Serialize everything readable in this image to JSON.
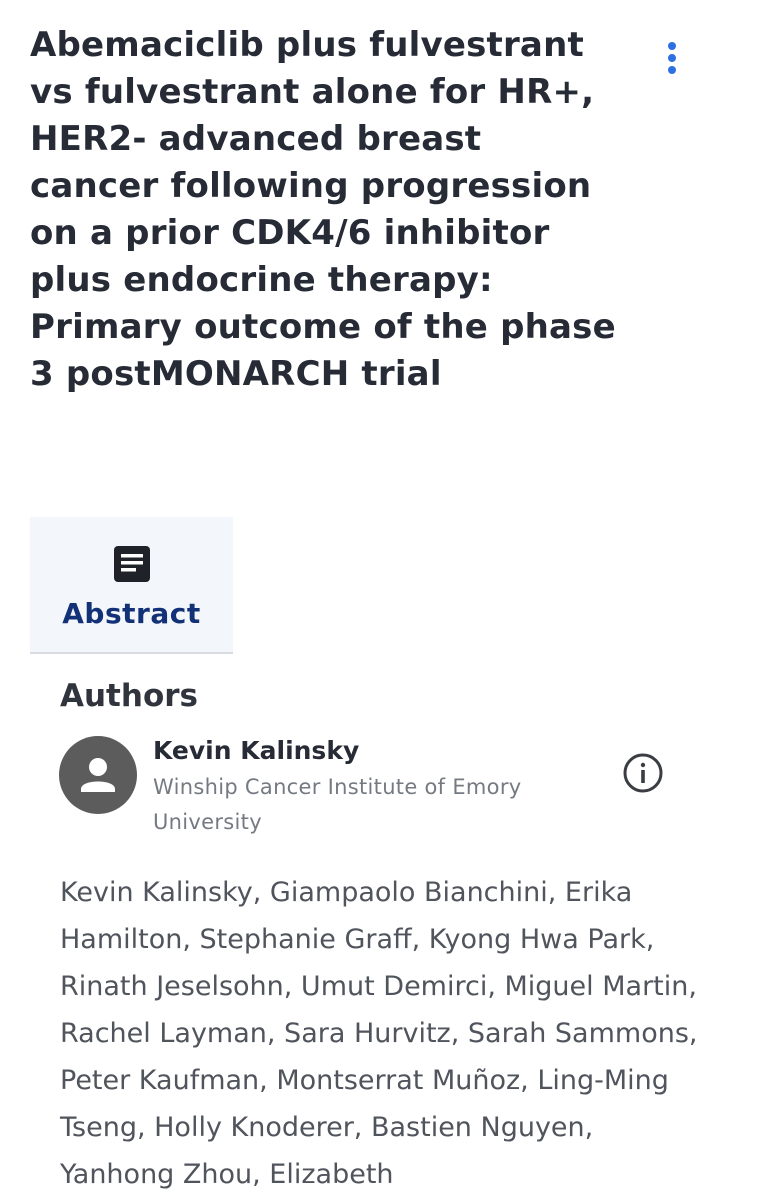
{
  "article": {
    "title": "Abemaciclib plus fulvestrant vs fulvestrant alone for HR+, HER2- advanced breast cancer following progression on a prior CDK4/6 inhibitor plus endocrine therapy: Primary outcome of the phase 3 postMONARCH trial"
  },
  "header": {
    "menu_icon": "more-vertical-icon"
  },
  "tabs": {
    "abstract_label": "Abstract",
    "abstract_icon": "article-icon"
  },
  "authors": {
    "heading": "Authors",
    "primary": {
      "name": "Kevin Kalinsky",
      "affiliation": "Winship Cancer Institute of Emory University",
      "avatar_icon": "person-icon",
      "info_icon": "info-icon"
    },
    "list_text": "Kevin Kalinsky, Giampaolo Bianchini, Erika Hamilton, Stephanie Graff, Kyong Hwa Park, Rinath Jeselsohn, Umut Demirci, Miguel Martin, Rachel Layman, Sara Hurvitz, Sarah Sammons, Peter Kaufman, Montserrat Muñoz, Ling-Ming Tseng, Holly Knoderer, Bastien Nguyen, Yanhong Zhou, Elizabeth"
  },
  "colors": {
    "accent_blue": "#2f6fe0",
    "tab_label": "#123177",
    "tab_background": "#f3f6fa",
    "avatar_bg": "#5c5c5c"
  }
}
